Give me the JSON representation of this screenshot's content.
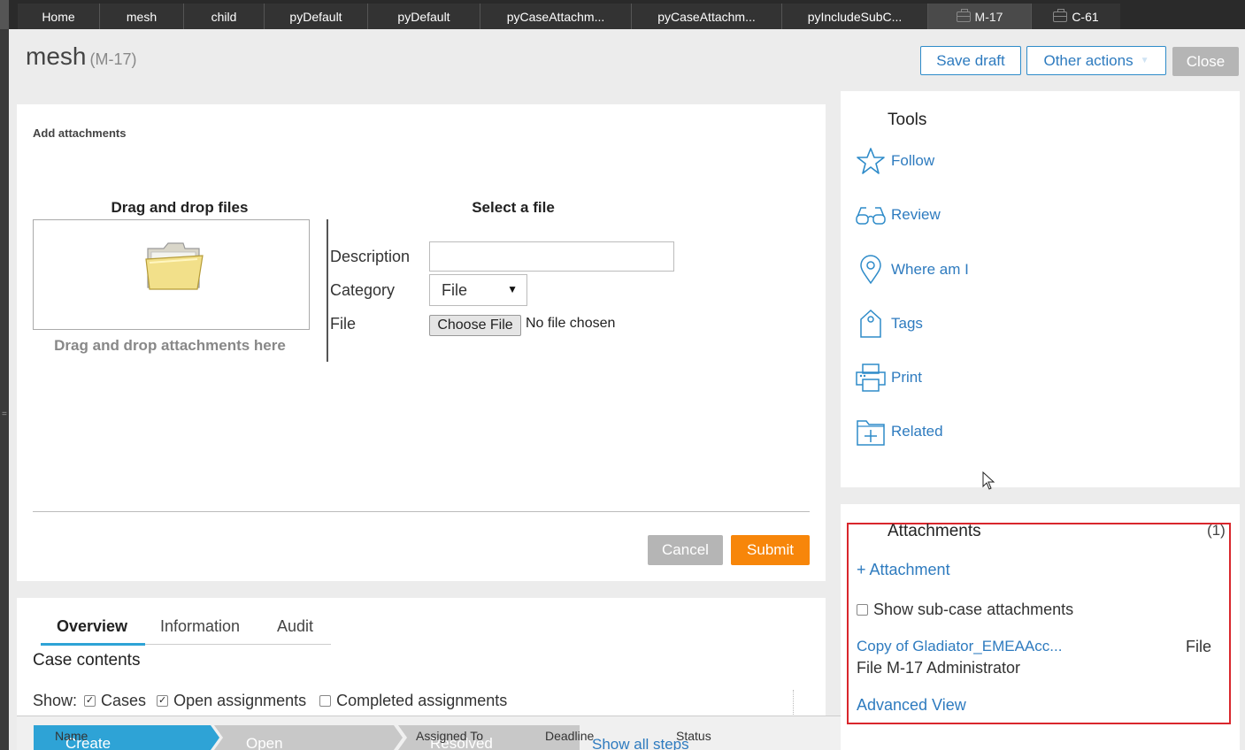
{
  "tabs": [
    {
      "label": "Home"
    },
    {
      "label": "mesh"
    },
    {
      "label": "child"
    },
    {
      "label": "pyDefault"
    },
    {
      "label": "pyDefault"
    },
    {
      "label": "pyCaseAttachm..."
    },
    {
      "label": "pyCaseAttachm..."
    },
    {
      "label": "pyIncludeSubC..."
    },
    {
      "label": "M-17"
    },
    {
      "label": "C-61"
    }
  ],
  "header": {
    "title": "mesh",
    "case_id": "(M-17)",
    "save_draft": "Save draft",
    "other_actions": "Other actions",
    "close": "Close"
  },
  "attach_form": {
    "section_title": "Add attachments",
    "drag_heading": "Drag and drop files",
    "drag_hint": "Drag and drop attachments here",
    "select_heading": "Select a file",
    "description_label": "Description",
    "description_value": "",
    "category_label": "Category",
    "category_value": "File",
    "file_label": "File",
    "choose_file": "Choose File",
    "no_file": "No file chosen",
    "cancel": "Cancel",
    "submit": "Submit"
  },
  "overview": {
    "tabs": [
      "Overview",
      "Information",
      "Audit"
    ],
    "case_contents": "Case contents",
    "show_label": "Show:",
    "filters": [
      {
        "label": "Cases",
        "checked": true
      },
      {
        "label": "Open assignments",
        "checked": true
      },
      {
        "label": "Completed assignments",
        "checked": false
      }
    ]
  },
  "stages": {
    "items": [
      "Create",
      "Open",
      "Resolved"
    ],
    "columns": [
      "Name",
      "Assigned To",
      "Deadline",
      "Status"
    ],
    "show_all": "Show all steps"
  },
  "tools": {
    "title": "Tools",
    "items": [
      {
        "label": "Follow",
        "icon": "star-icon"
      },
      {
        "label": "Review",
        "icon": "glasses-icon"
      },
      {
        "label": "Where am I",
        "icon": "map-pin-icon"
      },
      {
        "label": "Tags",
        "icon": "tag-icon"
      },
      {
        "label": "Print",
        "icon": "printer-icon"
      },
      {
        "label": "Related",
        "icon": "folder-plus-icon"
      }
    ]
  },
  "attachments": {
    "title": "Attachments",
    "count": "(1)",
    "add": "+ Attachment",
    "subcase_label": "Show sub-case attachments",
    "items": [
      {
        "name": "Copy of Gladiator_EMEAAcc...",
        "type": "File",
        "meta": "File M-17 Administrator"
      }
    ],
    "advanced": "Advanced View"
  },
  "colors": {
    "accent": "#2e7bbf",
    "submit": "#f7860a",
    "stage_active": "#2ea3d6",
    "highlight_border": "#d9262c"
  }
}
